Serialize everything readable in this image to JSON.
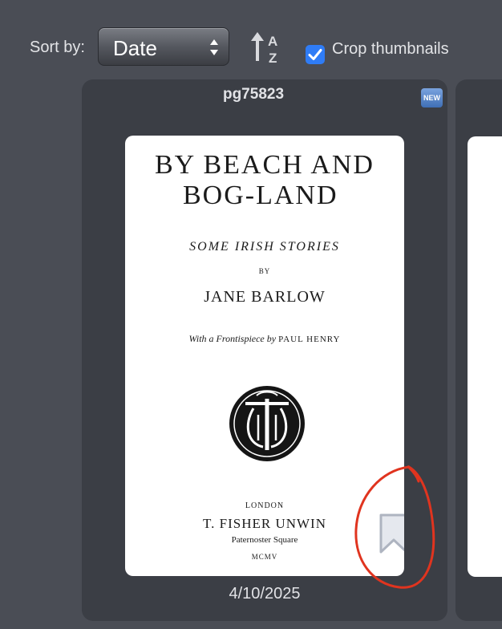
{
  "toolbar": {
    "sort_label": "Sort by:",
    "sort_value": "Date",
    "sort_direction_icon": "sort-ascending-az-icon",
    "crop_thumbnails_checked": true,
    "crop_thumbnails_label": "Crop thumbnails"
  },
  "cards": [
    {
      "title": "pg75823",
      "badge": "NEW",
      "date": "4/10/2025",
      "bookmark_icon": "bookmark-icon",
      "cover": {
        "title_line1": "BY BEACH AND",
        "title_line2": "BOG-LAND",
        "subtitle": "SOME IRISH STORIES",
        "by": "BY",
        "author": "JANE BARLOW",
        "frontispiece_prefix": "With a Frontispiece by",
        "frontispiece_artist": "PAUL HENRY",
        "emblem": "publisher-monogram-emblem",
        "place": "LONDON",
        "publisher": "T. FISHER UNWIN",
        "address": "Paternoster Square",
        "year": "MCMV"
      }
    }
  ],
  "colors": {
    "background": "#4a4d55",
    "card": "#3b3e45",
    "checkbox": "#2f7cf6",
    "badge": "#4f7fc4",
    "annotation": "#e0341f"
  }
}
